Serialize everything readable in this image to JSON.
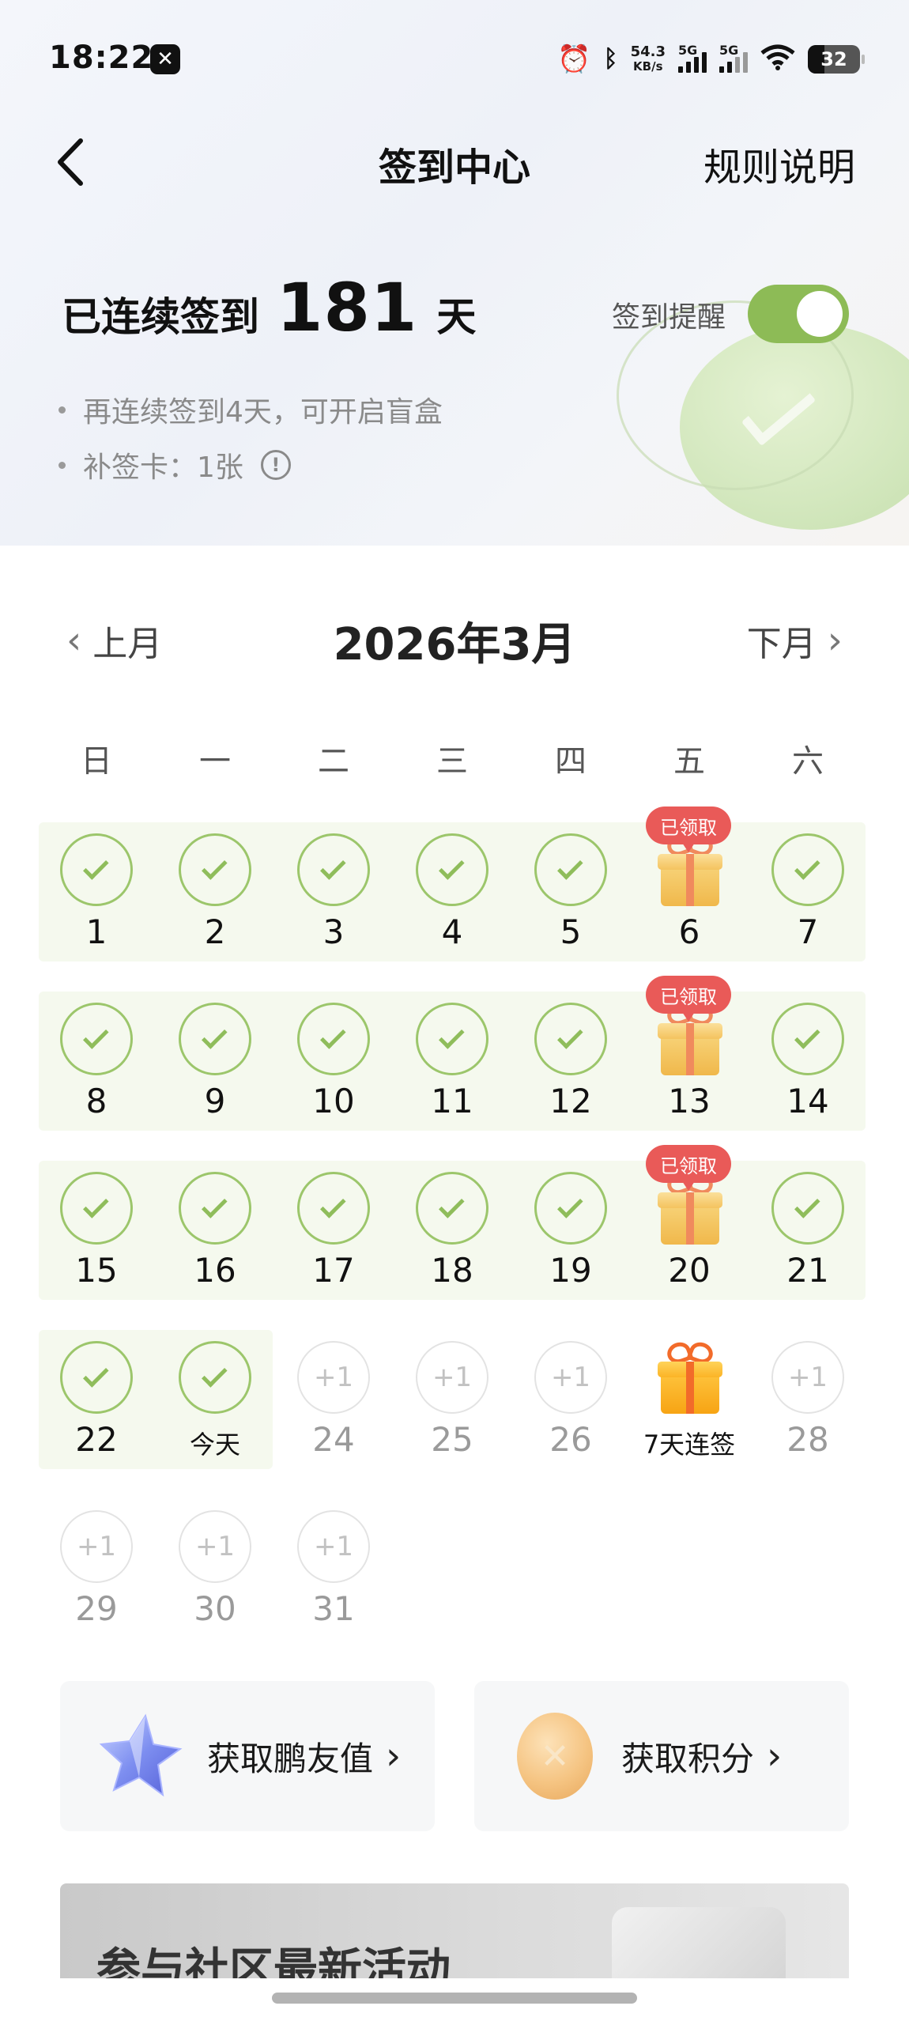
{
  "status_bar": {
    "time": "18:22",
    "net_speed_value": "54.3",
    "net_speed_unit": "KB/s",
    "sim1_label": "5G",
    "sim2_label": "5G",
    "battery": "32",
    "battery_level": 0.32
  },
  "nav": {
    "title": "签到中心",
    "rules": "规则说明"
  },
  "streak": {
    "prefix": "已连续签到",
    "days": "181",
    "suffix": "天"
  },
  "reminder": {
    "label": "签到提醒",
    "enabled": true
  },
  "info": {
    "blind_box_tip": "再连续签到4天，可开启盲盒",
    "makeup_card": "补签卡：1张",
    "info_glyph": "!"
  },
  "calendar": {
    "prev_label": "上月",
    "next_label": "下月",
    "month_title": "2026年3月",
    "weekdays": [
      "日",
      "一",
      "二",
      "三",
      "四",
      "五",
      "六"
    ],
    "claimed_label": "已领取",
    "plus_label": "+1",
    "days": [
      {
        "label": "1",
        "state": "checked"
      },
      {
        "label": "2",
        "state": "checked"
      },
      {
        "label": "3",
        "state": "checked"
      },
      {
        "label": "4",
        "state": "checked"
      },
      {
        "label": "5",
        "state": "checked"
      },
      {
        "label": "6",
        "state": "gift-claimed"
      },
      {
        "label": "7",
        "state": "checked"
      },
      {
        "label": "8",
        "state": "checked"
      },
      {
        "label": "9",
        "state": "checked"
      },
      {
        "label": "10",
        "state": "checked"
      },
      {
        "label": "11",
        "state": "checked"
      },
      {
        "label": "12",
        "state": "checked"
      },
      {
        "label": "13",
        "state": "gift-claimed"
      },
      {
        "label": "14",
        "state": "checked"
      },
      {
        "label": "15",
        "state": "checked"
      },
      {
        "label": "16",
        "state": "checked"
      },
      {
        "label": "17",
        "state": "checked"
      },
      {
        "label": "18",
        "state": "checked"
      },
      {
        "label": "19",
        "state": "checked"
      },
      {
        "label": "20",
        "state": "gift-claimed"
      },
      {
        "label": "21",
        "state": "checked"
      },
      {
        "label": "22",
        "state": "checked"
      },
      {
        "label": "今天",
        "state": "checked-today"
      },
      {
        "label": "24",
        "state": "pending"
      },
      {
        "label": "25",
        "state": "pending"
      },
      {
        "label": "26",
        "state": "pending"
      },
      {
        "label": "7天连签",
        "state": "gift-upcoming"
      },
      {
        "label": "28",
        "state": "pending"
      },
      {
        "label": "29",
        "state": "pending"
      },
      {
        "label": "30",
        "state": "pending"
      },
      {
        "label": "31",
        "state": "pending"
      }
    ]
  },
  "actions": {
    "friend_value": "获取鹏友值",
    "points": "获取积分",
    "chevron": "›"
  },
  "banner": {
    "title": "参与社区最新活动"
  },
  "colors": {
    "accent_green": "#8dbb56",
    "check_green": "#9cc66b",
    "badge_red": "#e95a58"
  }
}
